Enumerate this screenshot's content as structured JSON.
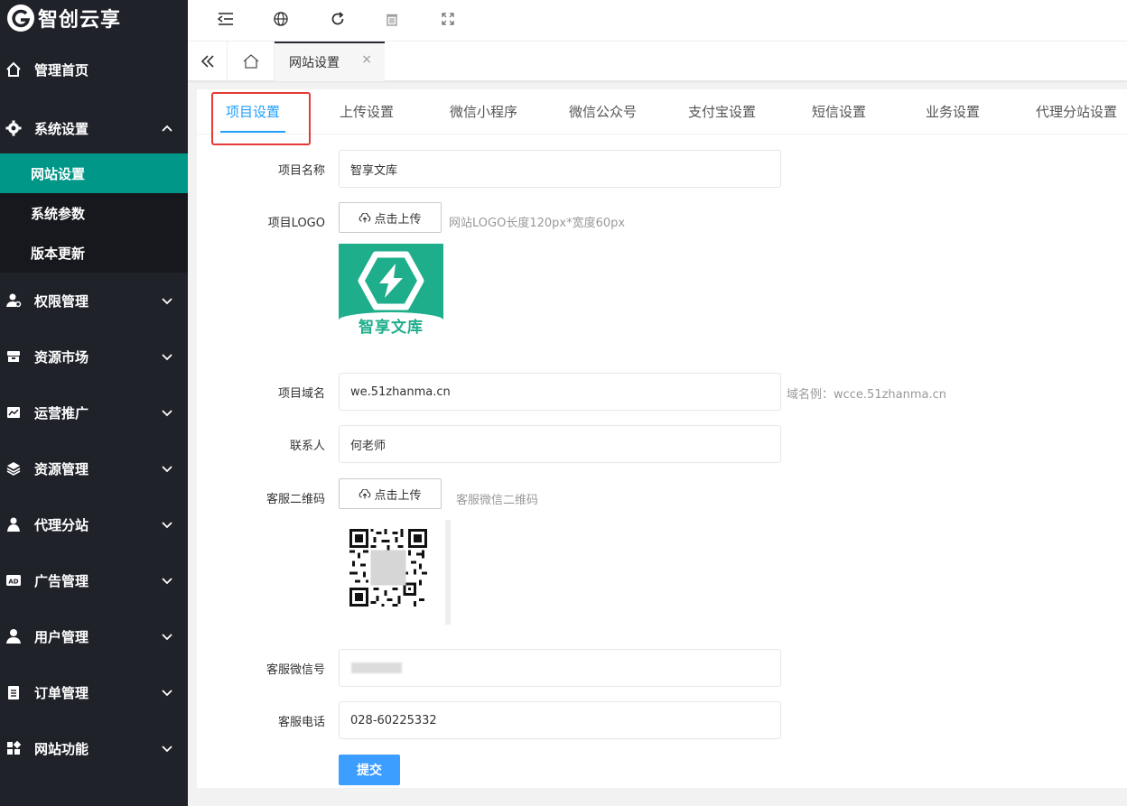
{
  "brand": {
    "name": "智创云享",
    "logo_icon": "brand-g-icon"
  },
  "sidebar": {
    "items": [
      {
        "label": "管理首页",
        "icon": "home-icon",
        "expandable": false
      },
      {
        "label": "系统设置",
        "icon": "gear-icon",
        "expandable": true,
        "expanded": true,
        "children": [
          {
            "label": "网站设置",
            "active": true
          },
          {
            "label": "系统参数",
            "active": false
          },
          {
            "label": "版本更新",
            "active": false
          }
        ]
      },
      {
        "label": "权限管理",
        "icon": "user-key-icon",
        "expandable": true
      },
      {
        "label": "资源市场",
        "icon": "store-icon",
        "expandable": true
      },
      {
        "label": "运营推广",
        "icon": "chart-box-icon",
        "expandable": true
      },
      {
        "label": "资源管理",
        "icon": "layers-icon",
        "expandable": true
      },
      {
        "label": "代理分站",
        "icon": "users-icon",
        "expandable": true
      },
      {
        "label": "广告管理",
        "icon": "ad-icon",
        "expandable": true
      },
      {
        "label": "用户管理",
        "icon": "user-icon",
        "expandable": true
      },
      {
        "label": "订单管理",
        "icon": "clipboard-icon",
        "expandable": true
      },
      {
        "label": "网站功能",
        "icon": "grid-icon",
        "expandable": true
      }
    ]
  },
  "topbar": {
    "tools": [
      "collapse-menu-icon",
      "globe-icon",
      "refresh-icon",
      "trash-icon",
      "fullscreen-icon"
    ]
  },
  "tabstrip": {
    "back_icon": "double-chevron-left-icon",
    "home_icon": "home-outline-icon",
    "open_tab": "网站设置",
    "close_glyph": "×"
  },
  "subtabs": [
    {
      "label": "项目设置",
      "active": true
    },
    {
      "label": "上传设置",
      "active": false
    },
    {
      "label": "微信小程序",
      "active": false
    },
    {
      "label": "微信公众号",
      "active": false
    },
    {
      "label": "支付宝设置",
      "active": false
    },
    {
      "label": "短信设置",
      "active": false
    },
    {
      "label": "业务设置",
      "active": false
    },
    {
      "label": "代理分站设置",
      "active": false
    }
  ],
  "form": {
    "project_name": {
      "label": "项目名称",
      "value": "智享文库"
    },
    "project_logo": {
      "label": "项目LOGO",
      "upload_label": "点击上传",
      "hint": "网站LOGO长度120px*宽度60px",
      "preview_text": "智享文库"
    },
    "project_domain": {
      "label": "项目域名",
      "value": "we.51zhanma.cn",
      "hint": "域名例：wcce.51zhanma.cn"
    },
    "contact": {
      "label": "联系人",
      "value": "何老师"
    },
    "service_qr": {
      "label": "客服二维码",
      "upload_label": "点击上传",
      "hint": "客服微信二维码"
    },
    "service_wechat": {
      "label": "客服微信号",
      "value": ""
    },
    "service_phone": {
      "label": "客服电话",
      "value": "028-60225332"
    },
    "submit_label": "提交"
  },
  "colors": {
    "sidebar_bg": "#20222a",
    "sidebar_active": "#009688",
    "accent_blue": "#1e9fff",
    "submit_blue": "#3c9eff",
    "logo_green": "#1fae8b",
    "highlight_red": "#e53935"
  }
}
